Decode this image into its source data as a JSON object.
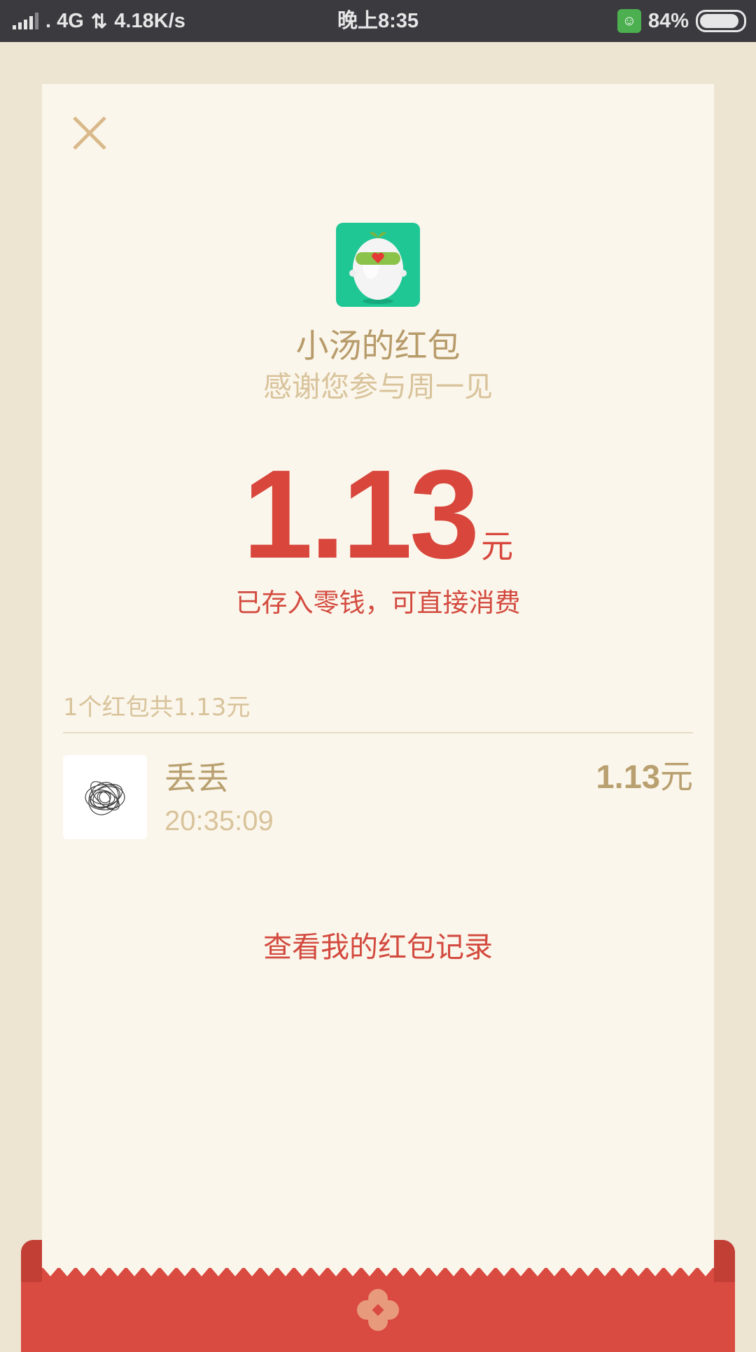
{
  "status_bar": {
    "network": ". 4G",
    "speed": "4.18K/s",
    "time": "晚上8:35",
    "battery": "84%"
  },
  "packet": {
    "sender_title": "小汤的红包",
    "greeting": "感谢您参与周一见",
    "amount": "1.13",
    "unit": "元",
    "stored_note": "已存入零钱，可直接消费"
  },
  "summary": "1个红包共1.13元",
  "records": [
    {
      "name": "丢丢",
      "time": "20:35:09",
      "amount": "1.13",
      "unit": "元"
    }
  ],
  "view_records_label": "查看我的红包记录",
  "colors": {
    "accent_red": "#d8463c",
    "gold": "#b79b6a",
    "envelope_red": "#d94a40"
  },
  "icons": [
    "close-icon",
    "sender-avatar",
    "recipient-avatar",
    "envelope-logo-icon"
  ]
}
